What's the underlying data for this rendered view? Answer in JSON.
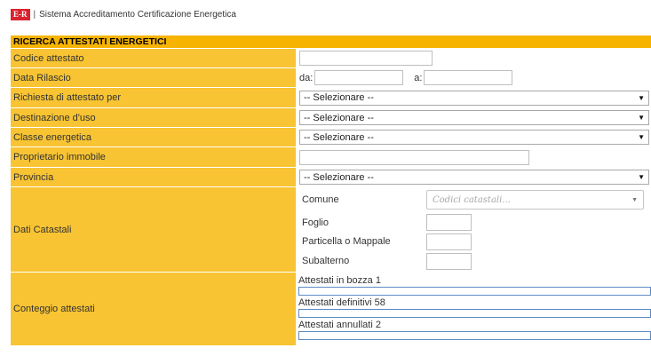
{
  "header": {
    "logo_text": "E-R",
    "separator": "|",
    "app_title": "Sistema Accreditamento Certificazione Energetica"
  },
  "form": {
    "title": "RICERCA ATTESTATI ENERGETICI",
    "codice_attestato": {
      "label": "Codice attestato",
      "value": ""
    },
    "data_rilascio": {
      "label": "Data Rilascio",
      "da_label": "da:",
      "a_label": "a:",
      "da_value": "",
      "a_value": ""
    },
    "richiesta": {
      "label": "Richiesta di attestato per",
      "selected": "-- Selezionare --"
    },
    "destinazione": {
      "label": "Destinazione d'uso",
      "selected": "-- Selezionare --"
    },
    "classe": {
      "label": "Classe energetica",
      "selected": "-- Selezionare --"
    },
    "proprietario": {
      "label": "Proprietario immobile",
      "value": ""
    },
    "provincia": {
      "label": "Provincia",
      "selected": "-- Selezionare --"
    },
    "dati_catastali": {
      "label": "Dati Catastali",
      "comune_label": "Comune",
      "comune_placeholder": "Codici catastali...",
      "foglio_label": "Foglio",
      "particella_label": "Particella o Mappale",
      "subalterno_label": "Subalterno"
    },
    "conteggio": {
      "label": "Conteggio attestati",
      "bozza": "Attestati in bozza 1",
      "definitivi": "Attestati definitivi 58",
      "annullati": "Attestati annullati 2"
    }
  },
  "colors": {
    "title_bar": "#f6b300",
    "label_bg": "#f8c433",
    "logo_bg": "#d9232e",
    "count_border": "#5d8bc4"
  },
  "icons": {
    "dropdown": "chevron-down-icon"
  }
}
